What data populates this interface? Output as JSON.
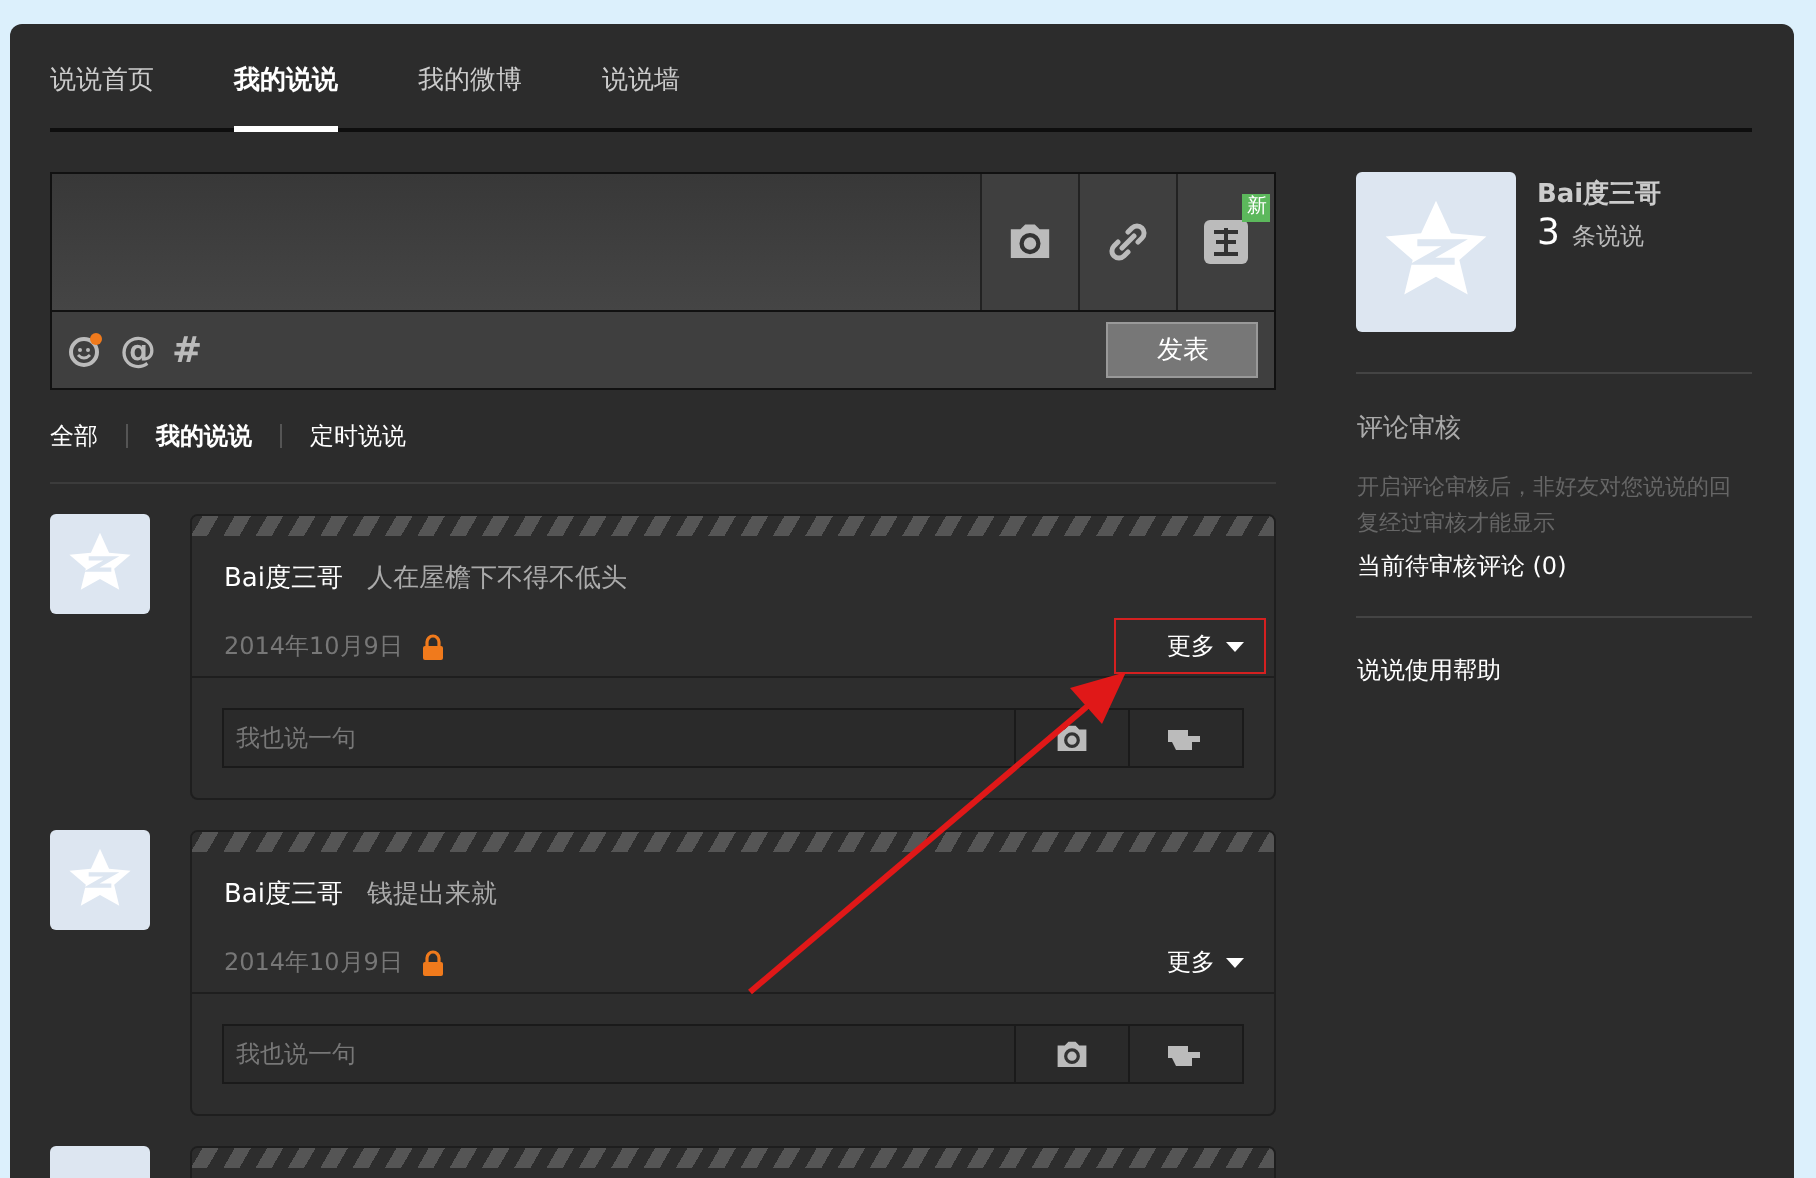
{
  "tabs": [
    {
      "label": "说说首页",
      "selected": false
    },
    {
      "label": "我的说说",
      "selected": true
    },
    {
      "label": "我的微博",
      "selected": false
    },
    {
      "label": "说说墙",
      "selected": false
    }
  ],
  "composer": {
    "badge": "新",
    "submit": "发表",
    "tools": [
      "@",
      "#"
    ],
    "emoji_notice": true
  },
  "filters": [
    {
      "label": "全部",
      "selected": false
    },
    {
      "label": "我的说说",
      "selected": true
    },
    {
      "label": "定时说说",
      "selected": false
    }
  ],
  "posts": [
    {
      "kind": "post",
      "author": "Bai度三哥",
      "text": "人在屋檐下不得不低头",
      "date": "2014年10月9日",
      "more": "更多",
      "highlighted": true,
      "comment_placeholder": "我也说一句"
    },
    {
      "kind": "post",
      "author": "Bai度三哥",
      "text": "钱提出来就",
      "date": "2014年10月9日",
      "more": "更多",
      "highlighted": false,
      "comment_placeholder": "我也说一句"
    },
    {
      "kind": "cut_off"
    }
  ],
  "profile": {
    "name": "Bai度三哥",
    "count": "3",
    "count_label": "条说说"
  },
  "review": {
    "title": "评论审核",
    "description": "开启评论审核后，非好友对您说说的回复经过审核才能显示",
    "pending": "当前待审核评论 (0)"
  },
  "help_link": "说说使用帮助"
}
